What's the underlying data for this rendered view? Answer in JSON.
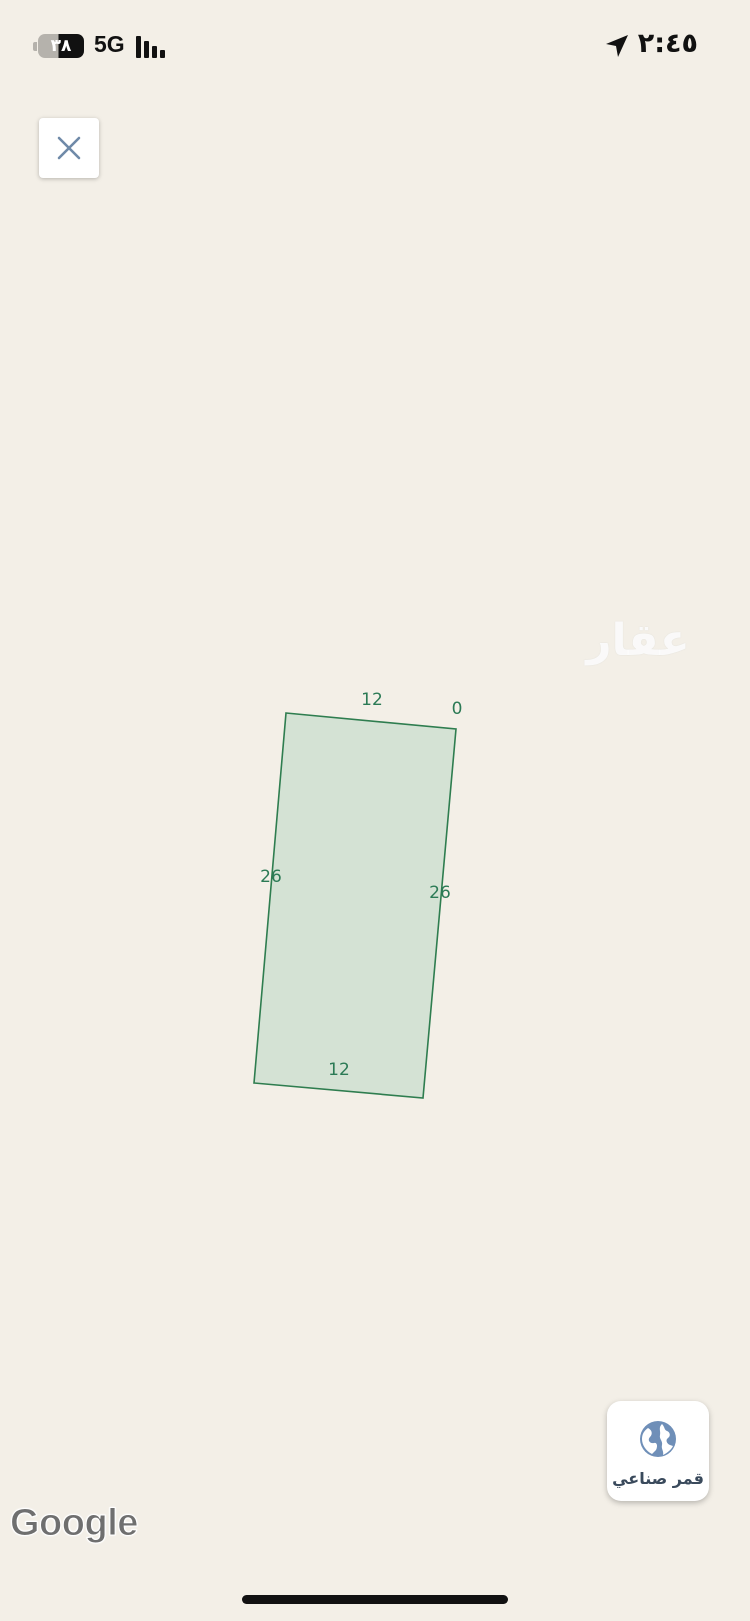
{
  "status_bar": {
    "battery_level": "٣٨",
    "network": "5G",
    "time": "٢:٤٥"
  },
  "close_button": {
    "icon": "close-icon"
  },
  "map": {
    "watermark": "عقار",
    "parcel": {
      "fill_color": "#d4e2d4",
      "stroke_color": "#2e7d4f",
      "edge_labels": {
        "top": "12",
        "bottom": "12",
        "left": "26",
        "right": "26",
        "corner": "0"
      }
    }
  },
  "satellite_button": {
    "label": "قمر صناعي",
    "icon": "globe-icon",
    "icon_color": "#6f8fb8"
  },
  "attribution": {
    "logo_text": "Google"
  },
  "colors": {
    "map_background": "#f3efe7",
    "label_green": "#2b7a55"
  }
}
